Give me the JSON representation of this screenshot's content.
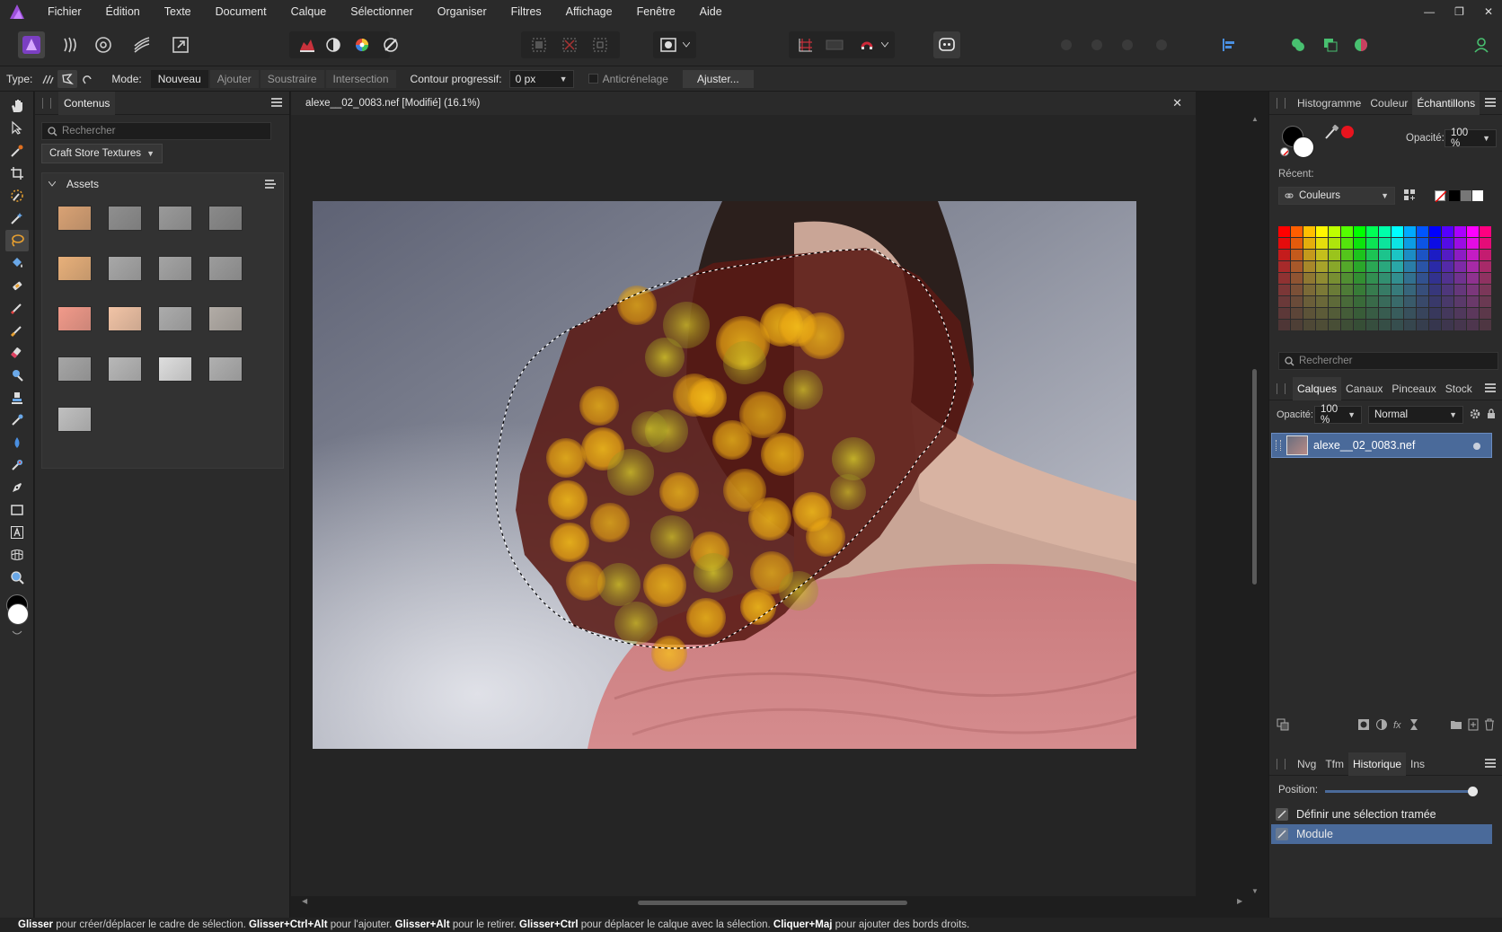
{
  "menubar": {
    "items": [
      "Fichier",
      "Édition",
      "Texte",
      "Document",
      "Calque",
      "Sélectionner",
      "Organiser",
      "Filtres",
      "Affichage",
      "Fenêtre",
      "Aide"
    ],
    "window_controls": [
      "—",
      "❐",
      "✕"
    ]
  },
  "context": {
    "type_label": "Type:",
    "mode_label": "Mode:",
    "modes": [
      "Nouveau",
      "Ajouter",
      "Soustraire",
      "Intersection"
    ],
    "active_mode": "Nouveau",
    "feather_label": "Contour progressif:",
    "feather_value": "0 px",
    "antialias_label": "Anticrénelage",
    "antialias_checked": false,
    "refine_button": "Ajuster..."
  },
  "contents_panel": {
    "tab": "Contenus",
    "search_placeholder": "Rechercher",
    "category": "Craft Store Textures",
    "group_title": "Assets",
    "thumb_colors": [
      "#d9a274",
      "#8f8f8f",
      "#9a9a9a",
      "#8a8a8a",
      "#e8b07a",
      "#a8a8a8",
      "#a4a4a4",
      "#9c9c9c",
      "#f29a8a",
      "#f2c4a6",
      "#acacac",
      "#b2aca6",
      "#a6a6a6",
      "#b8b8b8",
      "#dedede",
      "#b0b0b0",
      "#c0c0c0"
    ]
  },
  "document": {
    "title": "alexe__02_0083.nef [Modifié] (16.1%)"
  },
  "color_panel": {
    "tabs": [
      "Histogramme",
      "Couleur",
      "Échantillons"
    ],
    "active_tab": "Échantillons",
    "opacity_label": "Opacité:",
    "opacity_value": "100 %",
    "recent_label": "Récent:",
    "palette_name": "Couleurs",
    "search_placeholder": "Rechercher",
    "accent_red": "#e8141e"
  },
  "layers_panel": {
    "tabs": [
      "Calques",
      "Canaux",
      "Pinceaux",
      "Stock"
    ],
    "active_tab": "Calques",
    "opacity_label": "Opacité:",
    "opacity_value": "100 %",
    "blend_mode": "Normal",
    "layer_name": "alexe__02_0083.nef"
  },
  "history_panel": {
    "tabs": [
      "Nvg",
      "Tfm",
      "Historique",
      "Ins"
    ],
    "active_tab": "Historique",
    "position_label": "Position:",
    "position_value": 1.0,
    "items": [
      "Définir une sélection tramée",
      "Module"
    ],
    "active_item": "Module"
  },
  "statusbar": {
    "k1": "Glisser",
    "t1": " pour créer/déplacer le cadre de sélection. ",
    "k2": "Glisser+Ctrl+Alt",
    "t2": " pour l'ajouter. ",
    "k3": "Glisser+Alt",
    "t3": " pour le retirer. ",
    "k4": "Glisser+Ctrl",
    "t4": " pour déplacer le calque avec la sélection. ",
    "k5": "Cliquer+Maj",
    "t5": " pour ajouter des bords droits."
  }
}
